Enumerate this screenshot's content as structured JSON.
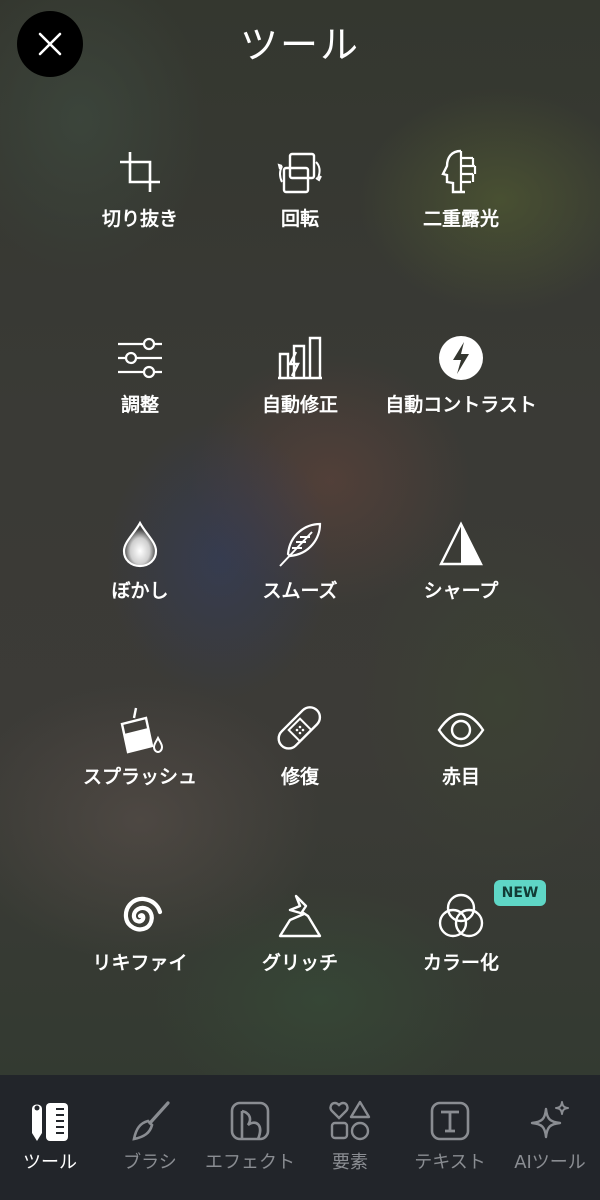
{
  "header": {
    "title": "ツール",
    "close_icon": "close-icon"
  },
  "tools": [
    {
      "label": "切り抜き",
      "icon": "crop-icon"
    },
    {
      "label": "回転",
      "icon": "rotate-icon"
    },
    {
      "label": "二重露光",
      "icon": "double-exposure-icon"
    },
    {
      "label": "調整",
      "icon": "sliders-icon"
    },
    {
      "label": "自動修正",
      "icon": "auto-fix-icon"
    },
    {
      "label": "自動コントラスト",
      "icon": "auto-contrast-icon"
    },
    {
      "label": "ぼかし",
      "icon": "blur-drop-icon"
    },
    {
      "label": "スムーズ",
      "icon": "feather-icon"
    },
    {
      "label": "シャープ",
      "icon": "sharpen-triangle-icon"
    },
    {
      "label": "スプラッシュ",
      "icon": "paint-bucket-icon"
    },
    {
      "label": "修復",
      "icon": "bandage-icon"
    },
    {
      "label": "赤目",
      "icon": "eye-icon"
    },
    {
      "label": "リキファイ",
      "icon": "swirl-icon"
    },
    {
      "label": "グリッチ",
      "icon": "glitch-icon"
    },
    {
      "label": "カラー化",
      "icon": "color-circles-icon"
    }
  ],
  "new_badge": "NEW",
  "tabbar": {
    "active": "ツール",
    "tabs": [
      {
        "label": "ツール",
        "icon": "tools-icon"
      },
      {
        "label": "ブラシ",
        "icon": "brush-icon"
      },
      {
        "label": "エフェクト",
        "icon": "effects-icon"
      },
      {
        "label": "要素",
        "icon": "elements-icon"
      },
      {
        "label": "テキスト",
        "icon": "text-icon"
      },
      {
        "label": "AIツール",
        "icon": "ai-sparkle-icon"
      }
    ]
  },
  "colors": {
    "badge": "#5fd6c6",
    "tabbar_bg": "#22252a",
    "inactive_tab": "#8a8d92",
    "active_tab": "#ffffff"
  }
}
